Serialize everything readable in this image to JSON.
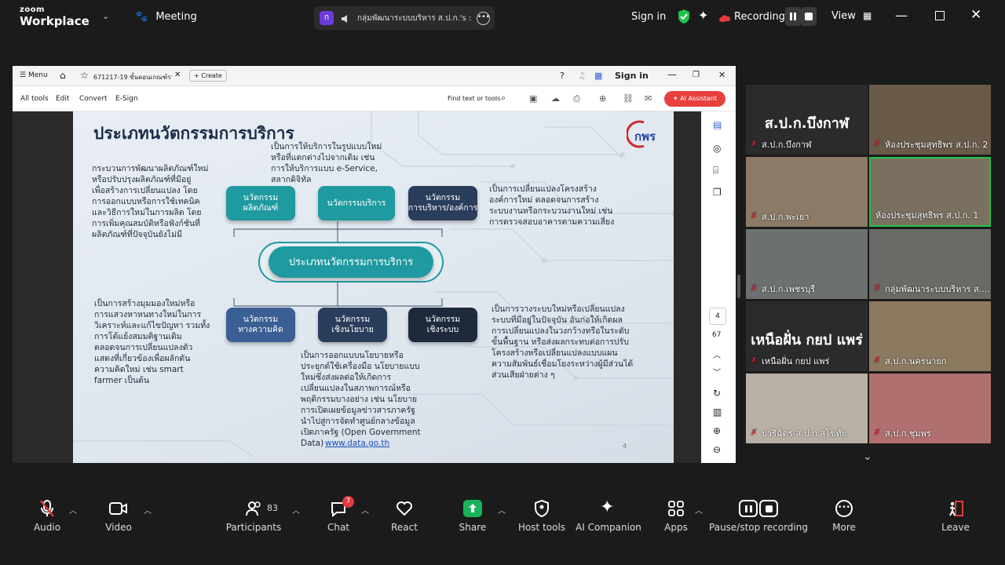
{
  "topbar": {
    "brand_small": "zoom",
    "brand_big": "Workplace",
    "meeting_label": "Meeting",
    "pill_badge": "ก",
    "pill_title": "กลุ่มพัฒนาระบบบริหาร ส.ป.ก.'s :",
    "sign_in": "Sign in",
    "recording": "Recording...",
    "view": "View"
  },
  "acrobat": {
    "menu": "Menu",
    "tab_title": "671217-19 ขั้นตอนเกณฑ์รางวัล...",
    "create": "Create",
    "sign_in": "Sign in",
    "tools": [
      "All tools",
      "Edit",
      "Convert",
      "E-Sign"
    ],
    "find": "Find text or tools",
    "ai_assistant": "AI Assistant",
    "page_current": "4",
    "page_total": "67"
  },
  "slide": {
    "title": "ประเภทนวัตกรรมการบริการ",
    "logo": "กพร",
    "center_node": "ประเภทนวัตกรรมการบริการ",
    "node_product": "นวัตกรรม\nผลิตภัณฑ์",
    "node_service": "นวัตกรรมบริการ",
    "node_admin": "นวัตกรรม\nการบริหาร/องค์การ",
    "node_concept": "นวัตกรรม\nทางความคิด",
    "node_policy": "นวัตกรรม\nเชิงนโยบาย",
    "node_system": "นวัตกรรม\nเชิงระบบ",
    "text_product": "กระบวนการพัฒนาผลิตภัณฑ์ใหม่\nหรือปรับปรุงผลิตภัณฑ์ที่มีอยู่\nเพื่อสร้างการเปลี่ยนแปลง โดย\nการออกแบบหรือการใช้เทคนิค\nและวิธีการใหม่ในการผลิต โดย\nการเพิ่มคุณสมบัติหรือฟังก์ชันที่\nผลิตภัณฑ์ที่ปัจจุบันยังไม่มี",
    "text_service": "เป็นการให้บริการในรูปแบบใหม่\nหรือที่แตกต่างไปจากเดิม เช่น\nการให้บริการแบบ e-Service,\nสลากดิจิทัล",
    "text_admin": "เป็นการเปลี่ยนแปลงโครงสร้าง\nองค์การใหม่ ตลอดจนการสร้าง\nระบบงานหรือกระบวนงานใหม่ เช่น\nการตรวจสอบอาคารตามความเสี่ยง",
    "text_concept": "เป็นการสร้างมุมมองใหม่หรือ\nการแสวงหาหนทางใหม่ในการ\nวิเคราะห์และแก้ไขปัญหา รวมทั้ง\nการโต้แย้งสมมติฐานเดิม\nตลอดจนการเปลี่ยนแปลงตัว\nแสดงที่เกี่ยวข้องเพื่อผลักดัน\nความคิดใหม่ เช่น smart\nfarmer เป็นต้น",
    "text_policy": "เป็นการออกแบบนโยบายหรือ\nประยุกต์ใช้เครื่องมือ นโยบายแบบ\nใหม่ซึ่งส่งผลต่อให้เกิดการ\nเปลี่ยนแปลงในสภาพการณ์หรือ\nพฤติกรรมบางอย่าง เช่น นโยบาย\nการเปิดเผยข้อมูลข่าวสารภาครัฐ\nนำไปสู่การจัดทำศูนย์กลางข้อมูล\nเปิดภาครัฐ (Open Government\nData)",
    "text_policy_link": "www.data.go.th",
    "text_system": "เป็นการวางระบบใหม่หรือเปลี่ยนแปลง\nระบบที่มีอยู่ในปัจจุบัน อันก่อให้เกิดผล\nการเปลี่ยนแปลงในวงกว้างหรือในระดับ\nขั้นพื้นฐาน หรือส่งผลกระทบต่อการปรับ\nโครงสร้างหรือเปลี่ยนแปลงแบบแผน\nความสัมพันธ์เชื่อมโยงระหว่างผู้มีส่วนได้\nส่วนเสียฝ่ายต่าง ๆ",
    "page_number": "4"
  },
  "tiles": [
    {
      "name": "ส.ป.ก.บึงกาฬ",
      "big": "ส.ป.ก.บึงกาฬ",
      "bg": "#2b2b2b"
    },
    {
      "name": "ห้องประชุมสุทธิพร ส.ป.ก. 2",
      "big": "",
      "bg": "#6a5a4a"
    },
    {
      "name": "ส.ป.ก.พะเยา",
      "big": "",
      "bg": "#8a7a66"
    },
    {
      "name": "ห้องประชุมสุทธิพร ส.ป.ก. 1",
      "big": "",
      "bg": "#7a7060"
    },
    {
      "name": "ส.ป.ก.เพชรบุรี",
      "big": "",
      "bg": "#6c7070"
    },
    {
      "name": "กลุ่มพัฒนาระบบบริหาร ส....",
      "big": "",
      "bg": "#6a6a66"
    },
    {
      "name": "เหนือฝั่น กยป แพร่",
      "big": "เหนือฝั่น กยป แพร่",
      "bg": "#2b2b2b"
    },
    {
      "name": "ส.ป.ก.นครนายก",
      "big": "",
      "bg": "#8c7a60"
    },
    {
      "name": "ปาริฉัตร-ส.ป.ก.สุโขทัย",
      "big": "",
      "bg": "#b8b0a4"
    },
    {
      "name": "ส.ป.ก.ชุมพร",
      "big": "",
      "bg": "#b07070"
    }
  ],
  "toolbar": {
    "audio": "Audio",
    "video": "Video",
    "participants": "Participants",
    "participants_count": "83",
    "chat": "Chat",
    "chat_badge": "7",
    "react": "React",
    "share": "Share",
    "host_tools": "Host tools",
    "ai_companion": "AI Companion",
    "apps": "Apps",
    "pause_stop": "Pause/stop recording",
    "more": "More",
    "leave": "Leave"
  },
  "colors": {
    "accent_green": "#1fc24a",
    "share_green": "#18b25a",
    "teal_node": "#1f9aa0",
    "navy_node": "#2a3d5b",
    "leave_red": "#e23b3b"
  }
}
